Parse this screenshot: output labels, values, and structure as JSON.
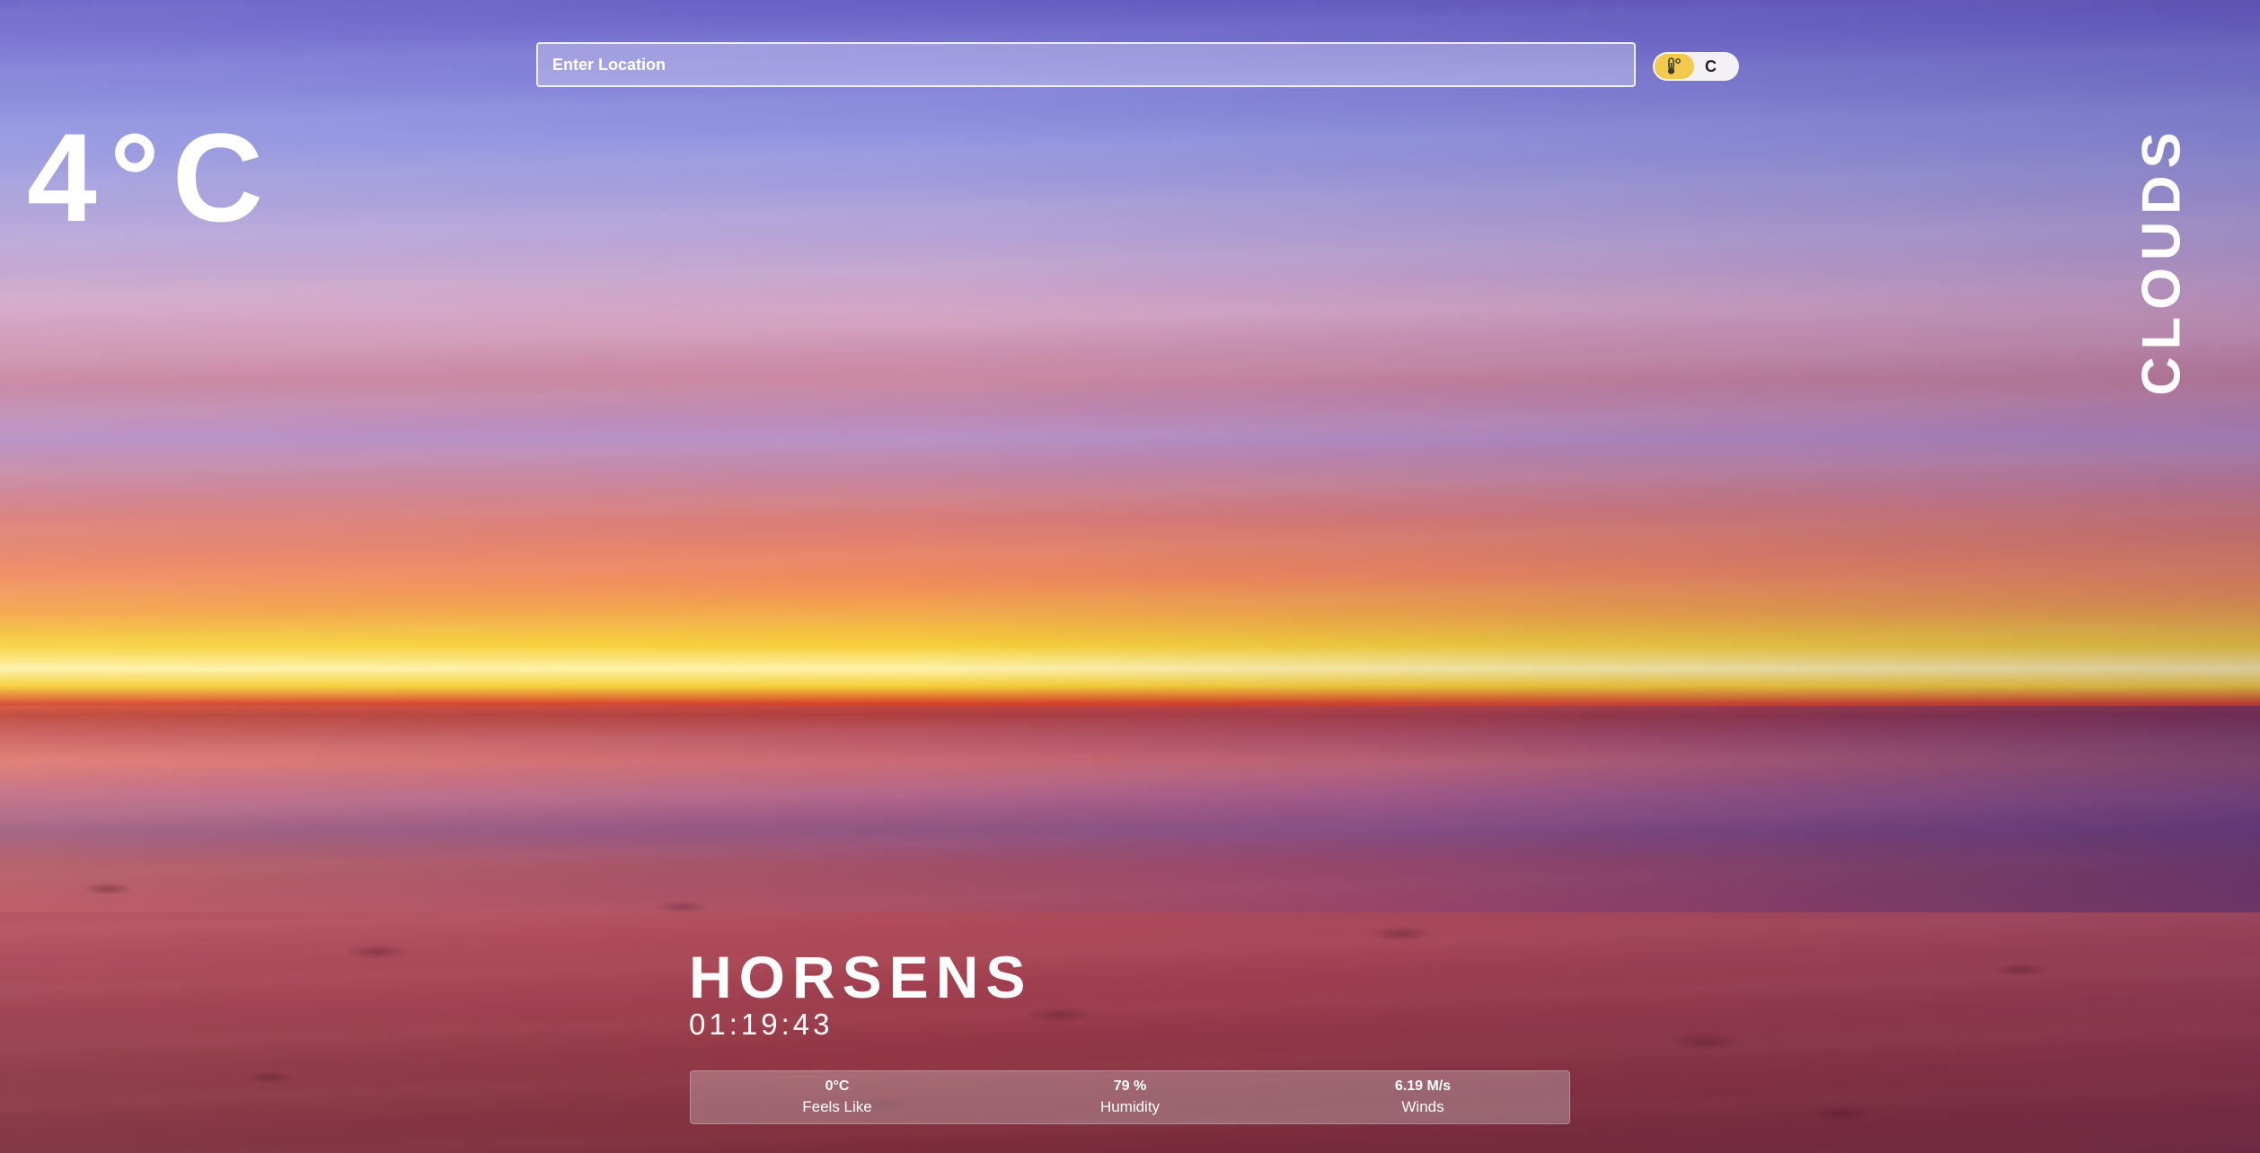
{
  "search": {
    "placeholder": "Enter Location"
  },
  "unit_toggle": {
    "icon": "thermometer-icon",
    "label": "C"
  },
  "weather": {
    "temperature": "4°C",
    "condition": "CLOUDS",
    "city": "HORSENS",
    "time": "01:19:43"
  },
  "stats": [
    {
      "value": "0°C",
      "label": "Feels Like"
    },
    {
      "value": "79 %",
      "label": "Humidity"
    },
    {
      "value": "6.19 M/s",
      "label": "Winds"
    }
  ],
  "colors": {
    "toggle_knob": "#f2c94c",
    "toggle_track": "#f3f1f6",
    "text": "#ffffff"
  }
}
